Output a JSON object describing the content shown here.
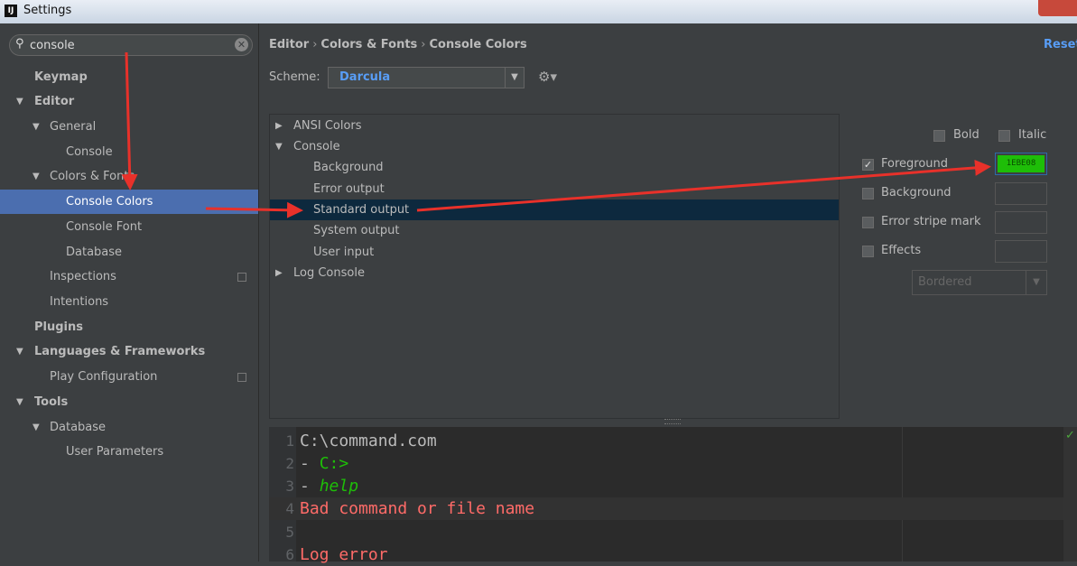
{
  "window": {
    "title": "Settings",
    "app_icon": "IJ"
  },
  "search": {
    "value": "console",
    "placeholder": ""
  },
  "sidebar": {
    "items": [
      {
        "label": "Keymap"
      },
      {
        "label": "Editor"
      },
      {
        "label": "General"
      },
      {
        "label": "Console"
      },
      {
        "label": "Colors & Fonts"
      },
      {
        "label": "Console Colors"
      },
      {
        "label": "Console Font"
      },
      {
        "label": "Database"
      },
      {
        "label": "Inspections"
      },
      {
        "label": "Intentions"
      },
      {
        "label": "Plugins"
      },
      {
        "label": "Languages & Frameworks"
      },
      {
        "label": "Play Configuration"
      },
      {
        "label": "Tools"
      },
      {
        "label": "Database"
      },
      {
        "label": "User Parameters"
      }
    ]
  },
  "breadcrumb": {
    "part1": "Editor",
    "part2": "Colors & Fonts",
    "part3": "Console Colors",
    "separator": "›"
  },
  "reset_label": "Reset",
  "scheme": {
    "label": "Scheme:",
    "value": "Darcula"
  },
  "options": {
    "items": [
      {
        "label": "ANSI Colors"
      },
      {
        "label": "Console"
      },
      {
        "label": "Background"
      },
      {
        "label": "Error output"
      },
      {
        "label": "Standard output"
      },
      {
        "label": "System output"
      },
      {
        "label": "User input"
      },
      {
        "label": "Log Console"
      }
    ]
  },
  "attributes": {
    "bold": "Bold",
    "italic": "Italic",
    "foreground": "Foreground",
    "foreground_color": "1EBE08",
    "background": "Background",
    "error_stripe": "Error stripe mark",
    "effects": "Effects",
    "effect_type": "Bordered"
  },
  "preview": {
    "lines": [
      {
        "num": "1",
        "text": "C:\\command.com",
        "color": "#bbbbbb"
      },
      {
        "num": "2",
        "text": "- C:>",
        "color": "#1ebe08"
      },
      {
        "num": "3",
        "text": "- help",
        "color": "#1ebe08"
      },
      {
        "num": "4",
        "text": "Bad command or file name",
        "color": "#ff6b68"
      },
      {
        "num": "5",
        "text": "",
        "color": "#bbbbbb"
      },
      {
        "num": "6",
        "text": "Log error",
        "color": "#ff6b68"
      }
    ]
  },
  "colors": {
    "accent": "#4b6eaf",
    "link": "#589df6",
    "selection_dark": "#0d293e",
    "foreground_swatch": "#1ebe08",
    "annotation_arrow": "#e8312a"
  }
}
